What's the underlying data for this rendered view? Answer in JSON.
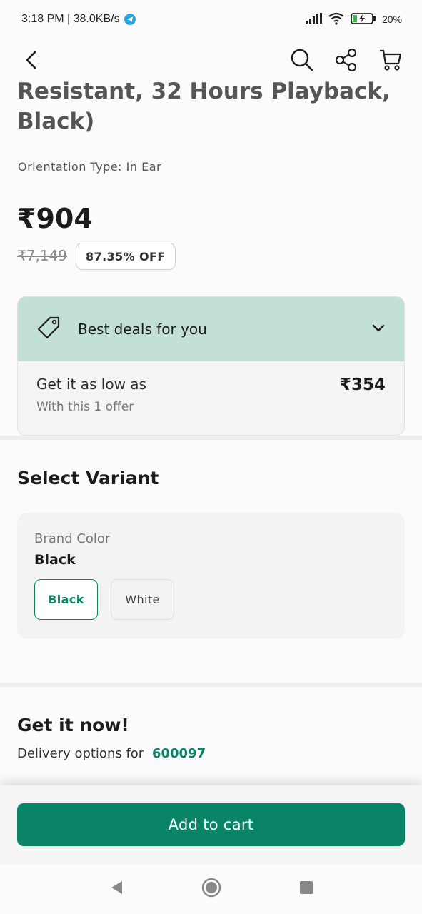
{
  "status_bar": {
    "time_speed": "3:18 PM | 38.0KB/s",
    "battery": "20%",
    "icons": [
      "telegram-icon",
      "signal-icon",
      "wifi-icon",
      "battery-charging-icon"
    ]
  },
  "header": {
    "icons": [
      "back-arrow-icon",
      "search-icon",
      "share-icon",
      "cart-icon"
    ]
  },
  "product": {
    "title_line1": "Resistant, 32 Hours Playback,",
    "title_line2": "Black)",
    "orientation": "Orientation Type: In Ear",
    "price": "₹904",
    "mrp": "₹7,149",
    "discount": "87.35% OFF"
  },
  "deals": {
    "title": "Best deals for you",
    "low_text": "Get it as low as",
    "offer_text": "With this 1 offer",
    "low_price": "₹354"
  },
  "variant": {
    "section_title": "Select Variant",
    "label": "Brand Color",
    "selected": "Black",
    "options": [
      "Black",
      "White"
    ]
  },
  "delivery": {
    "section_title": "Get it now!",
    "text": "Delivery options for",
    "pincode": "600097"
  },
  "cta": {
    "add_to_cart": "Add to cart"
  },
  "colors": {
    "accent": "#0a8466",
    "deals_header": "#c3e0d8"
  }
}
